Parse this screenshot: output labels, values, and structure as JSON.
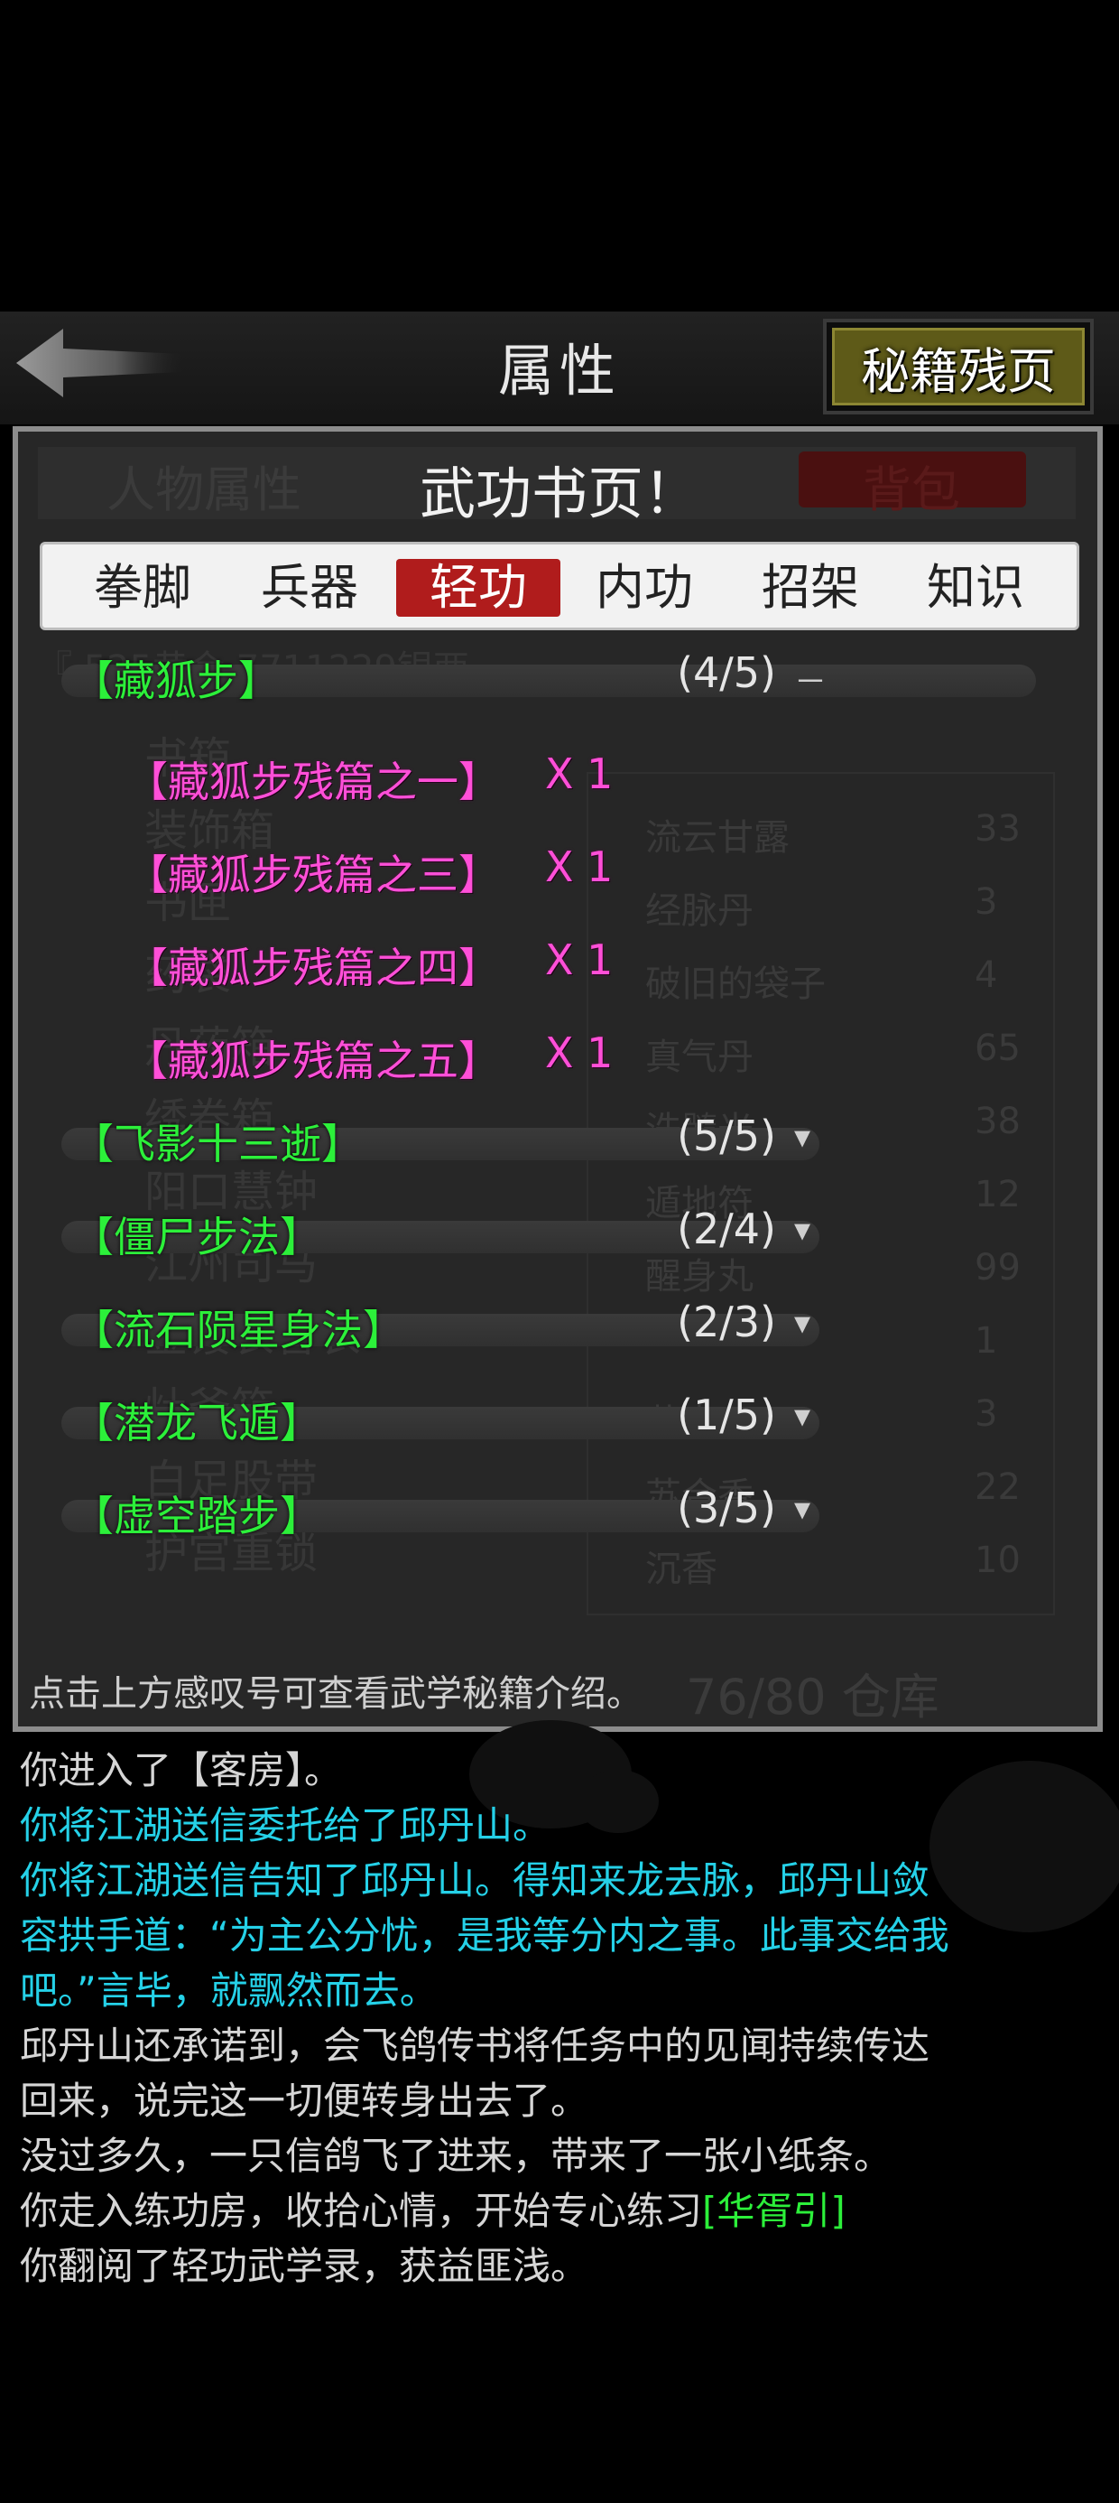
{
  "header": {
    "title": "属性",
    "secret_button": "秘籍残页"
  },
  "panel": {
    "heading": "武功书页",
    "heading_mark": "！",
    "ghost": {
      "tab_left": "人物属性",
      "tab_right": "背包",
      "coords_line": "『               525黄金  7711229银两",
      "left_items": [
        "书箱",
        "装饰箱",
        "书匣",
        "药袋",
        "丹药箱",
        "绣卷箱",
        "阳口慧钟",
        "江州司马",
        "金镂衣香衣",
        "灶爷箱",
        "白足股带",
        "护宫重锁"
      ],
      "right_items": [
        {
          "name": "流云甘露",
          "count": "33"
        },
        {
          "name": "经脉丹",
          "count": "3"
        },
        {
          "name": "破旧的袋子",
          "count": "4"
        },
        {
          "name": "真气丹",
          "count": "65"
        },
        {
          "name": "洗髓光",
          "count": "38"
        },
        {
          "name": "遁地符",
          "count": "12"
        },
        {
          "name": "醒身丸",
          "count": "99"
        },
        {
          "name": "",
          "count": "1"
        },
        {
          "name": "花毒",
          "count": "3"
        },
        {
          "name": "苏合香",
          "count": "22"
        },
        {
          "name": "沉香",
          "count": "10"
        }
      ],
      "storage": "76/80 仓库"
    }
  },
  "tabs": [
    {
      "label": "拳脚",
      "active": false
    },
    {
      "label": "兵器",
      "active": false
    },
    {
      "label": "轻功",
      "active": true
    },
    {
      "label": "内功",
      "active": false
    },
    {
      "label": "招架",
      "active": false
    },
    {
      "label": "知识",
      "active": false
    }
  ],
  "skills": [
    {
      "name": "【藏狐步】",
      "progress": "(4/5)",
      "toggle": "－",
      "expanded": true,
      "fragments": [
        {
          "name": "【藏狐步残篇之一】",
          "qty": "X 1"
        },
        {
          "name": "【藏狐步残篇之三】",
          "qty": "X 1"
        },
        {
          "name": "【藏狐步残篇之四】",
          "qty": "X 1"
        },
        {
          "name": "【藏狐步残篇之五】",
          "qty": "X 1"
        }
      ]
    },
    {
      "name": "【飞影十三逝】",
      "progress": "(5/5)",
      "toggle": "▾",
      "expanded": false
    },
    {
      "name": "【僵尸步法】",
      "progress": "(2/4)",
      "toggle": "▾",
      "expanded": false
    },
    {
      "name": "【流石陨星身法】",
      "progress": "(2/3)",
      "toggle": "▾",
      "expanded": false
    },
    {
      "name": "【潜龙飞遁】",
      "progress": "(1/5)",
      "toggle": "▾",
      "expanded": false
    },
    {
      "name": "【虚空踏步】",
      "progress": "(3/5)",
      "toggle": "▾",
      "expanded": false
    }
  ],
  "hint": "点击上方感叹号可查看武学秘籍介绍。",
  "log": [
    {
      "text": "你进入了【客房】。",
      "color": "white"
    },
    {
      "text": "你将江湖送信委托给了邱丹山。",
      "color": "cyan"
    },
    {
      "text": "你将江湖送信告知了邱丹山。得知来龙去脉，邱丹山敛",
      "color": "cyan"
    },
    {
      "text": "容拱手道：“为主公分忧，是我等分内之事。此事交给我",
      "color": "cyan"
    },
    {
      "text": "吧。”言毕，就飘然而去。",
      "color": "cyan"
    },
    {
      "text": "邱丹山还承诺到，会飞鸽传书将任务中的见闻持续传达",
      "color": "white"
    },
    {
      "text": "回来，说完这一切便转身出去了。",
      "color": "white"
    },
    {
      "text": "没过多久，一只信鸽飞了进来，带来了一张小纸条。",
      "color": "white"
    },
    {
      "text": "你走入练功房，收拾心情，开始专心练习",
      "color": "white",
      "tail": "[华胥引]",
      "tail_color": "green"
    },
    {
      "text": "你翻阅了轻功武学录，获益匪浅。",
      "color": "white"
    }
  ]
}
